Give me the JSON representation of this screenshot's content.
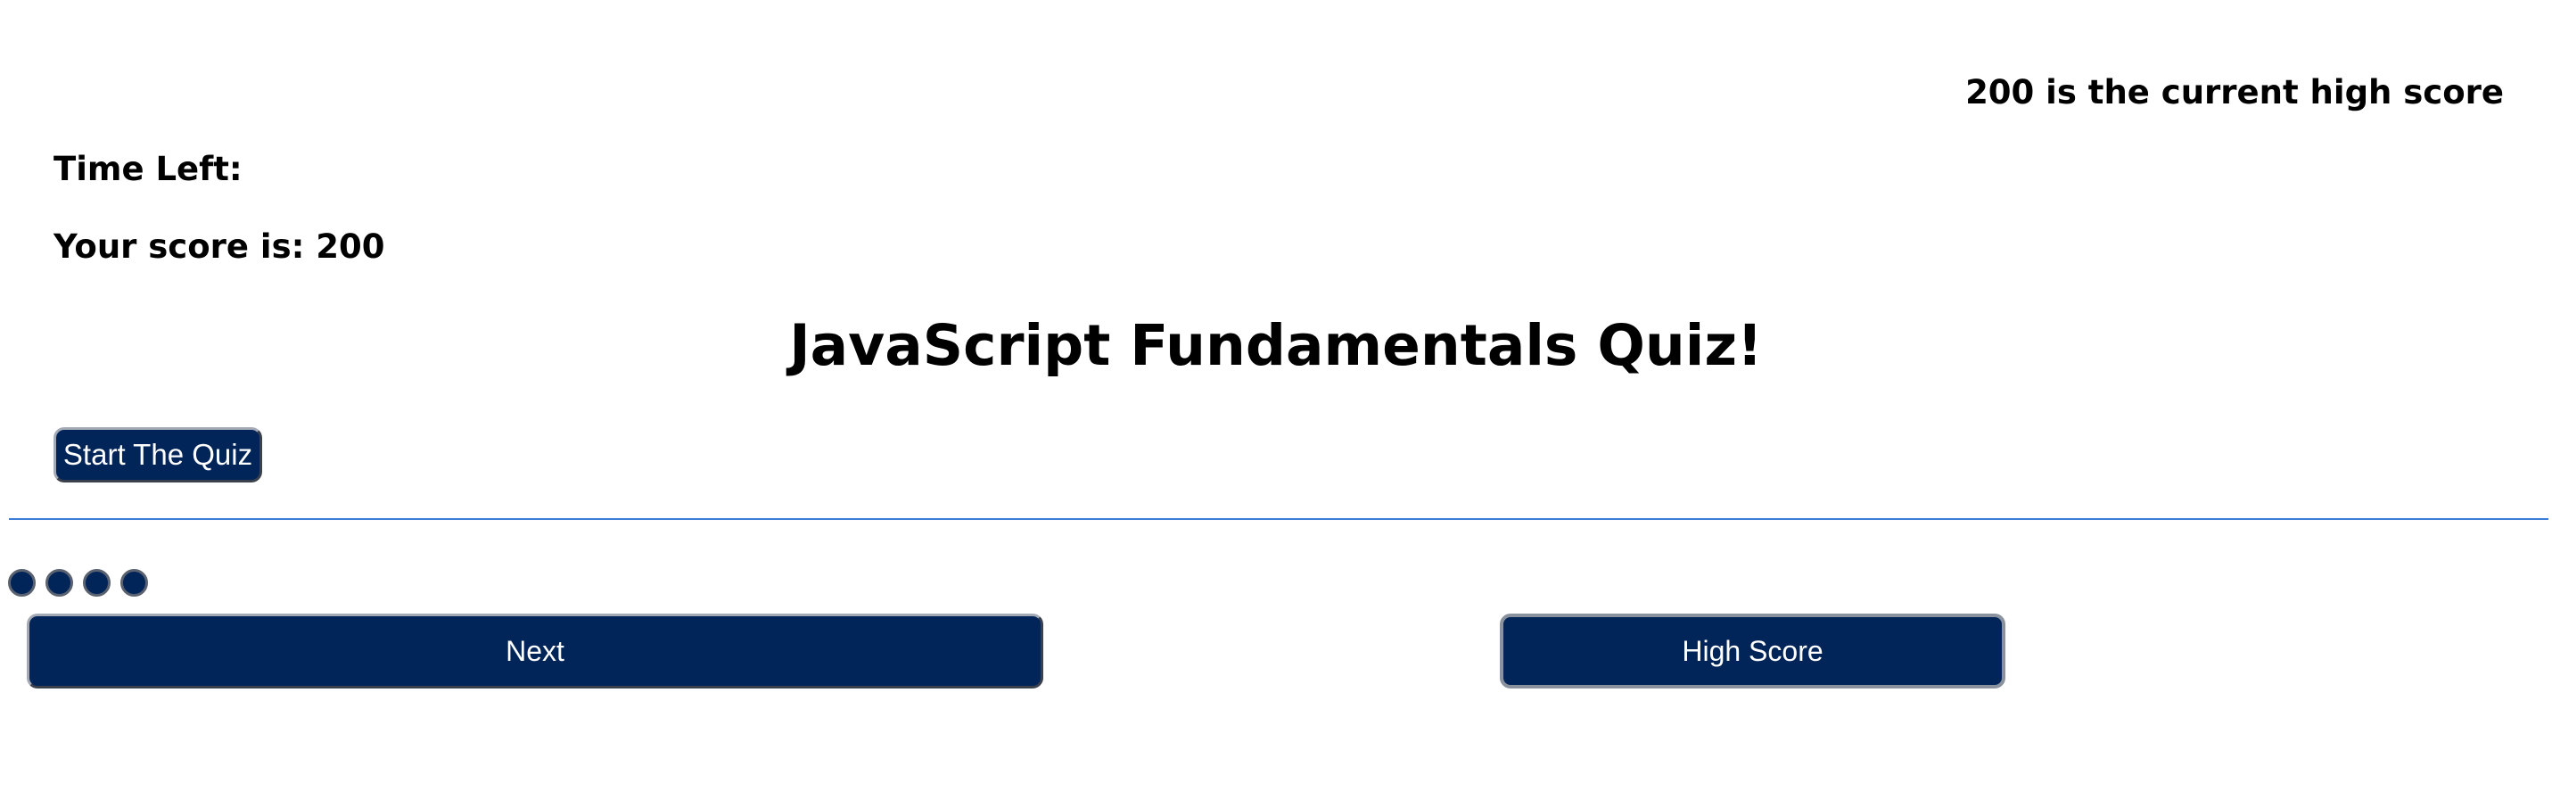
{
  "header": {
    "high_score_note": "200 is the current high score",
    "time_left_label": "Time Left:",
    "score_label": "Your score is: 200"
  },
  "main": {
    "title": "JavaScript Fundamentals Quiz!",
    "start_button_label": "Start The Quiz"
  },
  "progress": {
    "dot_count": 4
  },
  "footer": {
    "next_button_label": "Next",
    "high_score_button_label": "High Score"
  },
  "colors": {
    "button_bg": "#012459",
    "button_text": "#ffffff",
    "divider": "#3d7bd9"
  }
}
